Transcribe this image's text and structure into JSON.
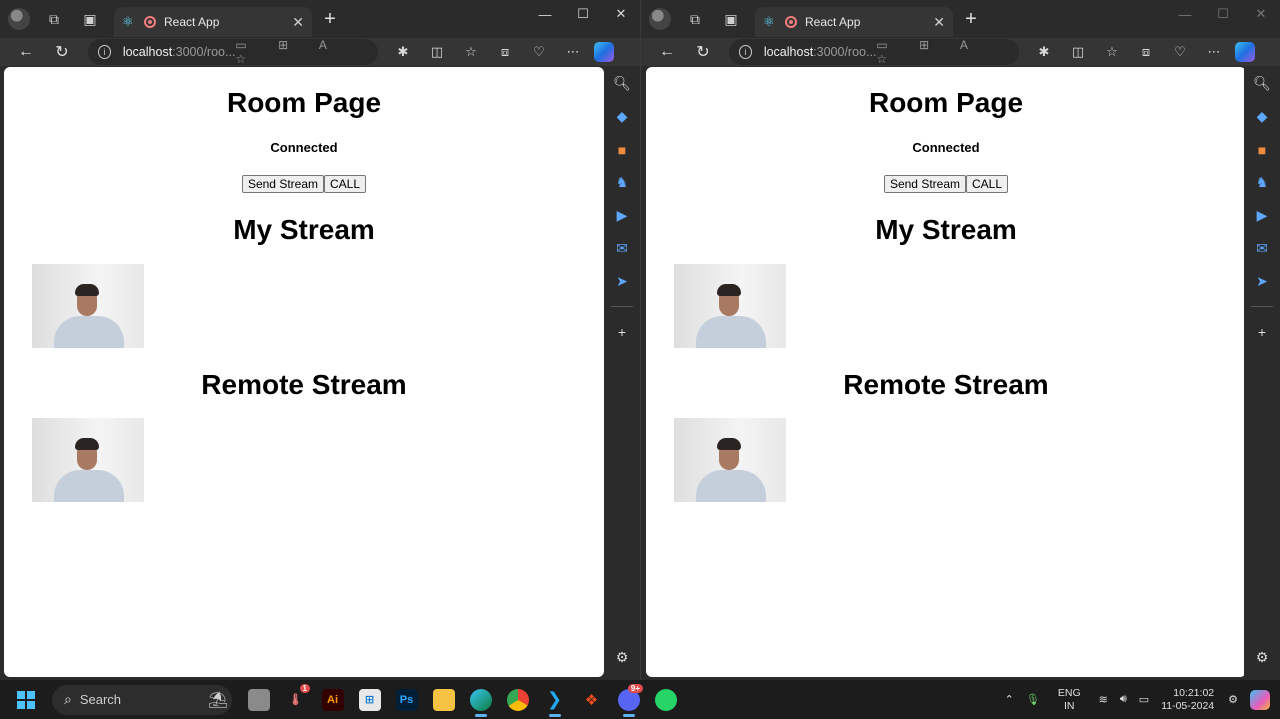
{
  "browsers": [
    {
      "tab": {
        "title": "React App"
      },
      "address": {
        "host": "localhost",
        "path": ":3000/roo..."
      },
      "page": {
        "title": "Room Page",
        "status": "Connected",
        "send_stream_label": "Send Stream",
        "call_label": "CALL",
        "my_stream_title": "My Stream",
        "remote_stream_title": "Remote Stream"
      }
    },
    {
      "tab": {
        "title": "React App"
      },
      "address": {
        "host": "localhost",
        "path": ":3000/roo..."
      },
      "page": {
        "title": "Room Page",
        "status": "Connected",
        "send_stream_label": "Send Stream",
        "call_label": "CALL",
        "my_stream_title": "My Stream",
        "remote_stream_title": "Remote Stream"
      }
    }
  ],
  "taskbar": {
    "search_label": "Search",
    "lang": {
      "line1": "ENG",
      "line2": "IN"
    },
    "time": "10:21:02",
    "date": "11-05-2024",
    "discord_badge": "9+",
    "notify_badge": "1"
  },
  "colors": {
    "accent": "#4cc2ff",
    "tab_bg": "#353535",
    "chrome_bg": "#2b2b2b",
    "page_bg": "#ffffff"
  }
}
